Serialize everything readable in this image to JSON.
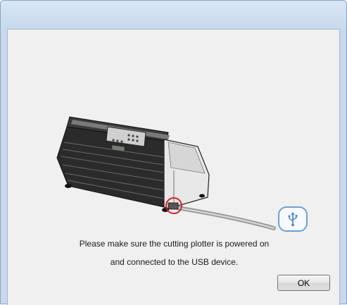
{
  "dialog": {
    "message_line1": "Please make sure the cutting plotter is powered on",
    "message_line2": "and connected to the USB device.",
    "ok_label": "OK"
  },
  "icons": {
    "usb": "usb-icon",
    "device": "cutting-plotter-illustration"
  },
  "colors": {
    "highlight_circle": "#d91f26",
    "usb_badge_border": "#6aa0d8"
  }
}
